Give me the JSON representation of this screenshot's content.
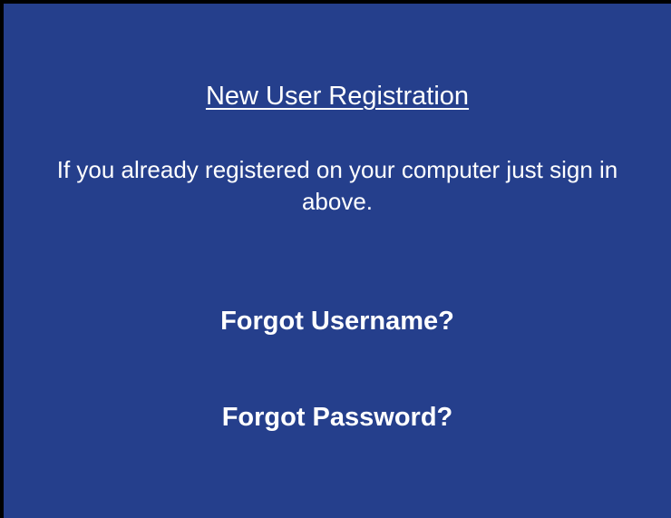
{
  "colors": {
    "background": "#000000",
    "panel": "#253f8c",
    "text": "#ffffff"
  },
  "registration": {
    "link_label": "New User Registration",
    "info_text": "If you already registered on your computer just sign in above."
  },
  "recovery": {
    "forgot_username_label": "Forgot Username?",
    "forgot_password_label": "Forgot Password?"
  }
}
